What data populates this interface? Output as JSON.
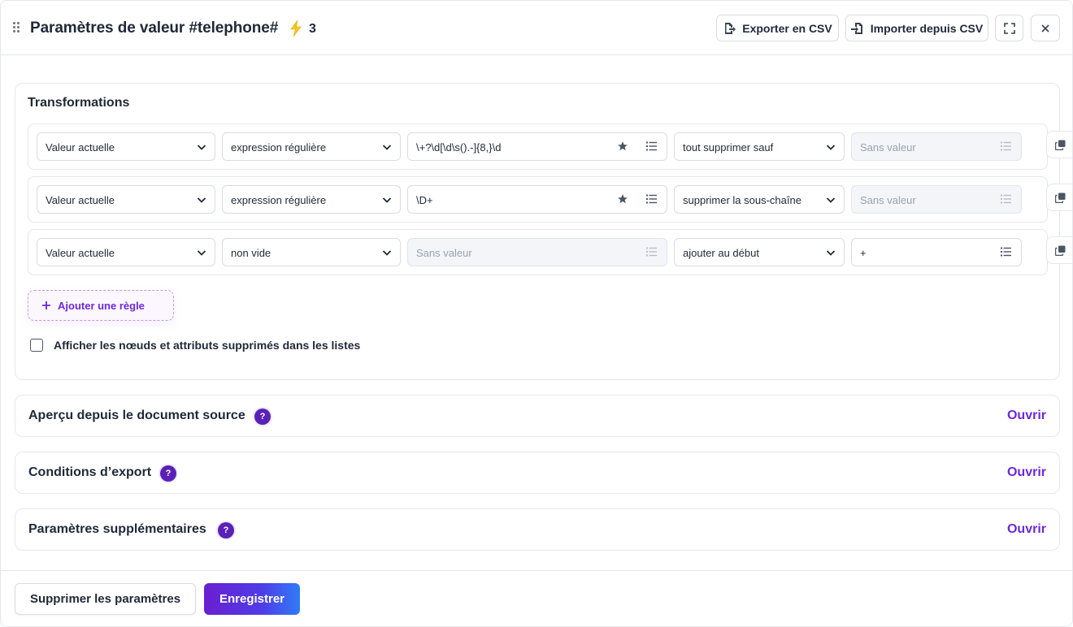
{
  "header": {
    "title": "Paramètres de valeur #telephone#",
    "count": "3",
    "export_label": "Exporter en CSV",
    "import_label": "Importer depuis CSV"
  },
  "transformations": {
    "title": "Transformations",
    "rules": [
      {
        "source": "Valeur actuelle",
        "condition": "expression régulière",
        "pattern": "\\+?\\d[\\d\\s().-]{8,}\\d",
        "action": "tout supprimer sauf",
        "value": "Sans valeur"
      },
      {
        "source": "Valeur actuelle",
        "condition": "expression régulière",
        "pattern": "\\D+",
        "action": "supprimer la sous-chaîne",
        "value": "Sans valeur"
      },
      {
        "source": "Valeur actuelle",
        "condition": "non vide",
        "pattern": "Sans valeur",
        "action": "ajouter au début",
        "value": "+"
      }
    ],
    "add_rule_label": "Ajouter une règle",
    "show_deleted_label": "Afficher les nœuds et attributs supprimés dans les listes",
    "show_deleted_checked": false
  },
  "sections": [
    {
      "title": "Aperçu depuis le document source",
      "help": "?",
      "open_label": "Ouvrir"
    },
    {
      "title": "Conditions d’export",
      "help": "?",
      "open_label": "Ouvrir"
    },
    {
      "title": "Paramètres supplémentaires",
      "help": "?",
      "open_label": "Ouvrir"
    }
  ],
  "footer": {
    "delete_label": "Supprimer les paramètres",
    "save_label": "Enregistrer"
  },
  "colors": {
    "accent": "#6d28d9",
    "help_badge": "#5b21b6",
    "bolt": "#f5c518"
  },
  "icons": {
    "drag": "drag-handle-icon",
    "bolt": "lightning-icon",
    "export": "file-export-icon",
    "import": "file-import-icon",
    "fullscreen": "fullscreen-icon",
    "close": "close-icon",
    "chevron": "chevron-down-icon",
    "star": "star-icon",
    "list": "list-icon",
    "copy": "copy-icon",
    "plus": "plus-icon",
    "help": "help-icon"
  }
}
